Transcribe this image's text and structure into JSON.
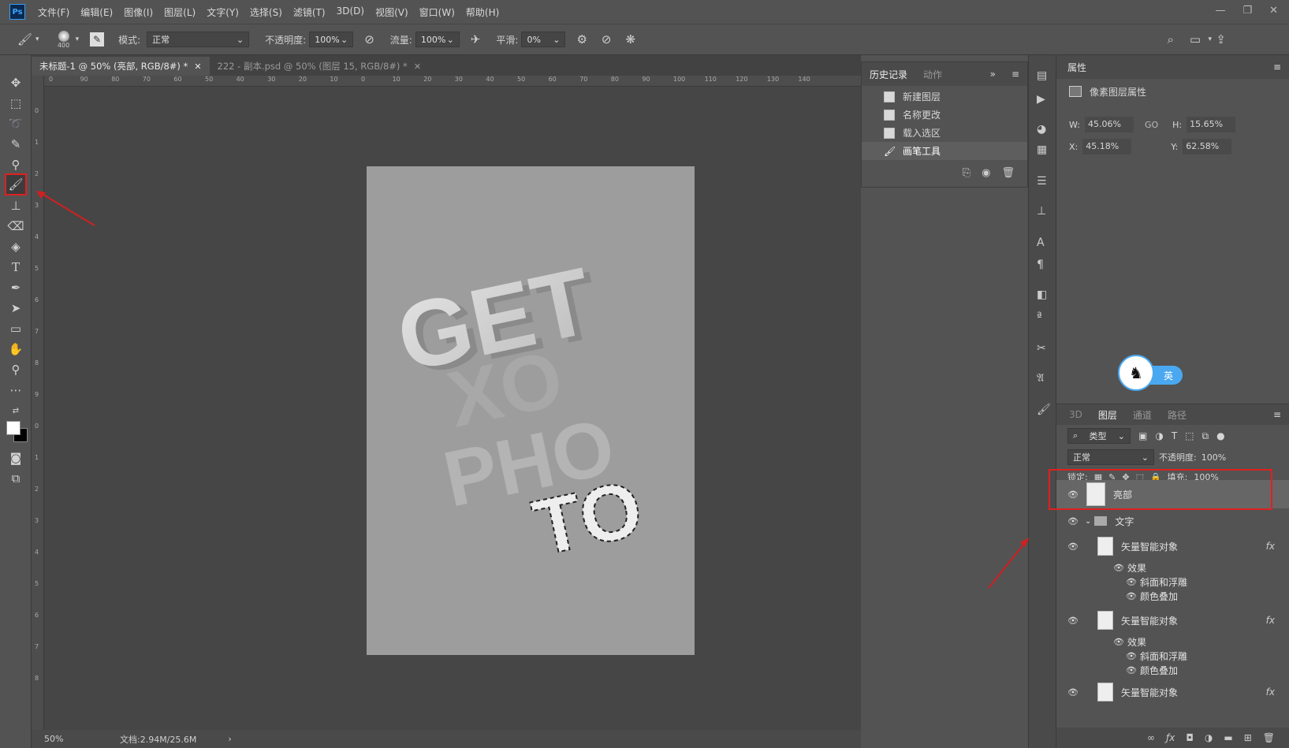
{
  "app": {
    "logo": "Ps"
  },
  "menu": [
    "文件(F)",
    "编辑(E)",
    "图像(I)",
    "图层(L)",
    "文字(Y)",
    "选择(S)",
    "滤镜(T)",
    "3D(D)",
    "视图(V)",
    "窗口(W)",
    "帮助(H)"
  ],
  "window_controls": [
    "—",
    "❐",
    "✕"
  ],
  "options": {
    "brush_size": "400",
    "mode_label": "模式:",
    "mode_value": "正常",
    "opacity_label": "不透明度:",
    "opacity_value": "100%",
    "flow_label": "流量:",
    "flow_value": "100%",
    "smooth_label": "平滑:",
    "smooth_value": "0%"
  },
  "tabs": [
    {
      "label": "未标题-1 @ 50% (亮部, RGB/8#) *",
      "close": "✕"
    },
    {
      "label": "222 - 副本.psd @ 50% (图层 15, RGB/8#) *",
      "close": "✕"
    }
  ],
  "ruler_h_ticks": [
    "0",
    "90",
    "80",
    "70",
    "60",
    "50",
    "40",
    "30",
    "20",
    "10",
    "0",
    "10",
    "20",
    "30",
    "40",
    "50",
    "60",
    "70",
    "80",
    "90",
    "100",
    "110",
    "120",
    "130",
    "140"
  ],
  "ruler_v_ticks": [
    "0",
    "1",
    "2",
    "3",
    "4",
    "5",
    "6",
    "7",
    "8",
    "9",
    "0",
    "1",
    "2",
    "3",
    "4",
    "5",
    "6",
    "7",
    "8"
  ],
  "poster": {
    "line1": "GET",
    "line2": "XO",
    "line3": "PHO",
    "line4": "TO"
  },
  "status": {
    "zoom": "50%",
    "doc": "文档:2.94M/25.6M",
    "arrow": "›"
  },
  "history": {
    "tabs": [
      "历史记录",
      "动作"
    ],
    "items": [
      "新建图层",
      "名称更改",
      "载入选区",
      "画笔工具"
    ],
    "active_index": 3
  },
  "properties": {
    "title": "属性",
    "subtitle": "像素图层属性",
    "w_label": "W:",
    "w_value": "45.06%",
    "link": "GO",
    "h_label": "H:",
    "h_value": "15.65%",
    "x_label": "X:",
    "x_value": "45.18%",
    "y_label": "Y:",
    "y_value": "62.58%"
  },
  "ime": {
    "label": "英"
  },
  "layers_panel": {
    "tabs": [
      "3D",
      "图层",
      "通道",
      "路径"
    ],
    "filter_label": "类型",
    "blend_mode": "正常",
    "opacity_label": "不透明度:",
    "opacity_value": "100%",
    "lock_label": "锁定:",
    "fill_label": "填充:",
    "fill_value": "100%",
    "layers": [
      {
        "name": "亮部",
        "type": "pixel"
      },
      {
        "name": "文字",
        "type": "group"
      },
      {
        "name": "矢量智能对象",
        "type": "smart",
        "fx": "fx"
      },
      {
        "name": "效果",
        "type": "effects"
      },
      {
        "name": "斜面和浮雕",
        "type": "effect"
      },
      {
        "name": "颜色叠加",
        "type": "effect"
      },
      {
        "name": "矢量智能对象",
        "type": "smart",
        "fx": "fx"
      },
      {
        "name": "效果",
        "type": "effects"
      },
      {
        "name": "斜面和浮雕",
        "type": "effect"
      },
      {
        "name": "颜色叠加",
        "type": "effect"
      },
      {
        "name": "矢量智能对象",
        "type": "smart",
        "fx": "fx"
      }
    ]
  },
  "colors": {
    "accent_red": "#e02020",
    "bg": "#535353",
    "canvas": "#464646",
    "doc": "#9d9d9d"
  }
}
